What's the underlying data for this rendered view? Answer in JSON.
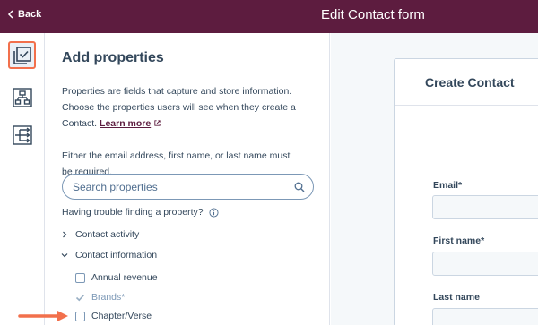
{
  "header": {
    "back_label": "Back",
    "title": "Edit Contact form",
    "background_color": "#5d1c3f"
  },
  "rail": {
    "items": [
      {
        "icon": "form-fields-icon",
        "active": true
      },
      {
        "icon": "hierarchy-icon",
        "active": false
      },
      {
        "icon": "branching-icon",
        "active": false
      }
    ],
    "active_highlight_color": "#f2704c"
  },
  "panel": {
    "heading": "Add properties",
    "description": "Properties are fields that capture and store information. Choose the properties users will see when they create a Contact.",
    "learn_more": "Learn more",
    "requirement_note": "Either the email address, first name, or last name must be required.",
    "search_placeholder": "Search properties",
    "trouble_text": "Having trouble finding a property?",
    "groups": [
      {
        "label": "Contact activity",
        "expanded": false
      },
      {
        "label": "Contact information",
        "expanded": true
      }
    ],
    "properties": [
      {
        "label": "Annual revenue",
        "checked": false
      },
      {
        "label": "Brands*",
        "checked": true,
        "disabled": true
      },
      {
        "label": "Chapter/Verse",
        "checked": false
      }
    ]
  },
  "preview": {
    "title": "Create Contact",
    "fields": [
      {
        "label": "Email*",
        "value": ""
      },
      {
        "label": "First name*",
        "value": ""
      },
      {
        "label": "Last name",
        "value": ""
      }
    ]
  },
  "annotation": {
    "arrow_color": "#f2704c"
  }
}
